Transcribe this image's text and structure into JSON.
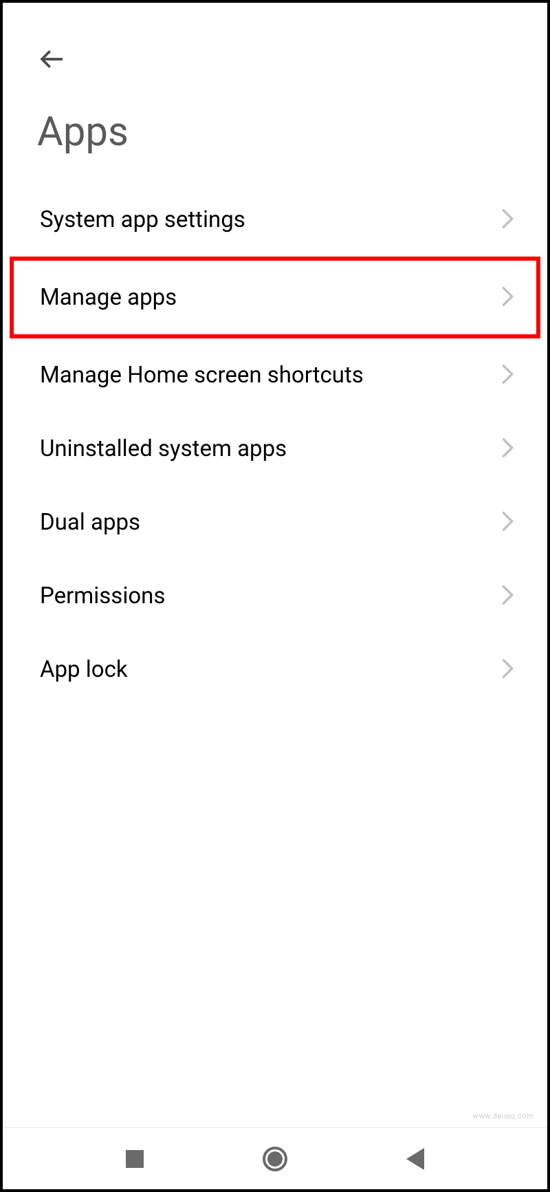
{
  "header": {
    "title": "Apps"
  },
  "items": [
    {
      "label": "System app settings",
      "highlighted": false
    },
    {
      "label": "Manage apps",
      "highlighted": true
    },
    {
      "label": "Manage Home screen shortcuts",
      "highlighted": false
    },
    {
      "label": "Uninstalled system apps",
      "highlighted": false
    },
    {
      "label": "Dual apps",
      "highlighted": false
    },
    {
      "label": "Permissions",
      "highlighted": false
    },
    {
      "label": "App lock",
      "highlighted": false
    }
  ],
  "watermark": "www.deuaq.com"
}
